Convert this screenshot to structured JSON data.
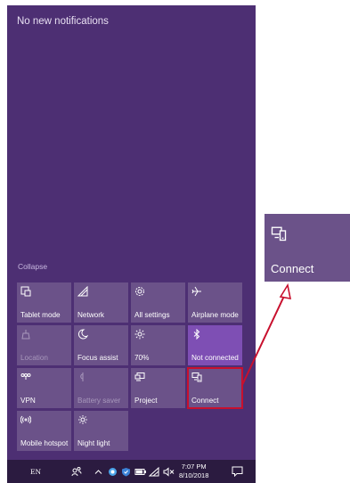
{
  "notifications": {
    "empty_text": "No new notifications"
  },
  "collapse_label": "Collapse",
  "tiles": [
    {
      "label": "Tablet mode",
      "icon": "tablet-mode-icon",
      "state": "normal"
    },
    {
      "label": "Network",
      "icon": "network-icon",
      "state": "normal"
    },
    {
      "label": "All settings",
      "icon": "gear-icon",
      "state": "normal"
    },
    {
      "label": "Airplane mode",
      "icon": "airplane-icon",
      "state": "normal"
    },
    {
      "label": "Location",
      "icon": "location-icon",
      "state": "off"
    },
    {
      "label": "Focus assist",
      "icon": "moon-icon",
      "state": "normal"
    },
    {
      "label": "70%",
      "icon": "brightness-icon",
      "state": "normal"
    },
    {
      "label": "Not connected",
      "icon": "bluetooth-icon",
      "state": "on"
    },
    {
      "label": "VPN",
      "icon": "vpn-icon",
      "state": "normal"
    },
    {
      "label": "Battery saver",
      "icon": "battery-saver-icon",
      "state": "off"
    },
    {
      "label": "Project",
      "icon": "project-icon",
      "state": "normal"
    },
    {
      "label": "Connect",
      "icon": "connect-icon",
      "state": "normal",
      "highlighted": true
    },
    {
      "label": "Mobile hotspot",
      "icon": "mobile-hotspot-icon",
      "state": "normal"
    },
    {
      "label": "Night light",
      "icon": "night-light-icon",
      "state": "normal"
    }
  ],
  "taskbar": {
    "language": "EN",
    "time": "7:07 PM",
    "date": "8/10/2018"
  },
  "callout": {
    "label": "Connect",
    "icon": "connect-icon"
  },
  "colors": {
    "panel_bg": "#4d2f73",
    "tile_bg": "#6b5289",
    "tile_active_bg": "#7e4fb4",
    "highlight": "#c8102e",
    "taskbar_bg": "#2b1b40"
  }
}
